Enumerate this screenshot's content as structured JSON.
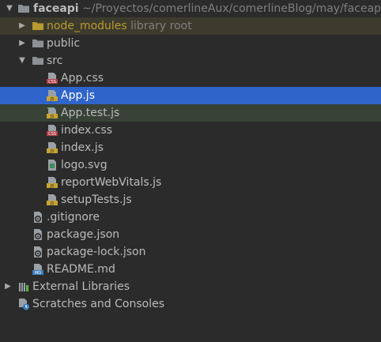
{
  "project": {
    "name": "faceapi",
    "path": "~/Proyectos/comerlineAux/comerlineBlog/may/faceapi"
  },
  "tree": {
    "node_modules": {
      "label": "node_modules",
      "hint": "library root"
    },
    "public": "public",
    "src": "src",
    "files": {
      "app_css": "App.css",
      "app_js": "App.js",
      "app_test_js": "App.test.js",
      "index_css": "index.css",
      "index_js": "index.js",
      "logo_svg": "logo.svg",
      "report_web_vitals": "reportWebVitals.js",
      "setup_tests": "setupTests.js"
    },
    "gitignore": ".gitignore",
    "package_json": "package.json",
    "package_lock": "package-lock.json",
    "readme": "README.md",
    "external_libraries": "External Libraries",
    "scratches": "Scratches and Consoles"
  },
  "icon_badges": {
    "css": "CSS",
    "js": "JS",
    "md": "MD"
  },
  "colors": {
    "background": "#2b2b2b",
    "selection": "#2f65ca",
    "library_root_row": "#3d3b2d",
    "test_row": "#384236",
    "folder": "#8c9196",
    "excluded_folder": "#b89b2e"
  }
}
